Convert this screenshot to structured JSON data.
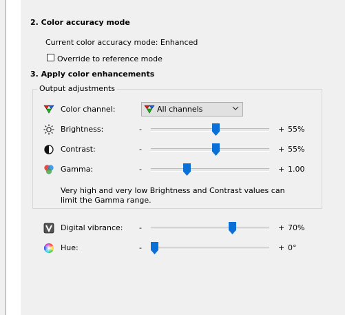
{
  "section2": {
    "title": "2. Color accuracy mode",
    "current_mode_text": "Current color accuracy mode: Enhanced",
    "override_label": "Override to reference mode",
    "override_checked": false
  },
  "section3": {
    "title": "3. Apply color enhancements",
    "output_adjustments": {
      "group_label": "Output adjustments",
      "color_channel_label": "Color channel:",
      "color_channel_value": "All channels",
      "brightness": {
        "label": "Brightness:",
        "minus": "-",
        "plus": "+",
        "value": "55%",
        "fraction": 0.55
      },
      "contrast": {
        "label": "Contrast:",
        "minus": "-",
        "plus": "+",
        "value": "55%",
        "fraction": 0.55
      },
      "gamma": {
        "label": "Gamma:",
        "minus": "-",
        "plus": "+",
        "value": "1.00",
        "fraction": 0.29
      },
      "note": "Very high and very low Brightness and Contrast values can limit the Gamma range."
    },
    "digital_vibrance": {
      "label": "Digital vibrance:",
      "minus": "-",
      "plus": "+",
      "value": "70%",
      "fraction": 0.7
    },
    "hue": {
      "label": "Hue:",
      "minus": "-",
      "plus": "+",
      "value": "0°",
      "fraction": 0.0
    }
  },
  "icons": {
    "color_channel": "rgb-channels-icon",
    "brightness": "sun-icon",
    "contrast": "contrast-icon",
    "gamma": "gamma-color-circles-icon",
    "digital_vibrance": "vibrance-icon",
    "hue": "color-wheel-icon"
  },
  "colors": {
    "accent": "#0a6fd6",
    "panel_bg": "#f0f0f0"
  }
}
